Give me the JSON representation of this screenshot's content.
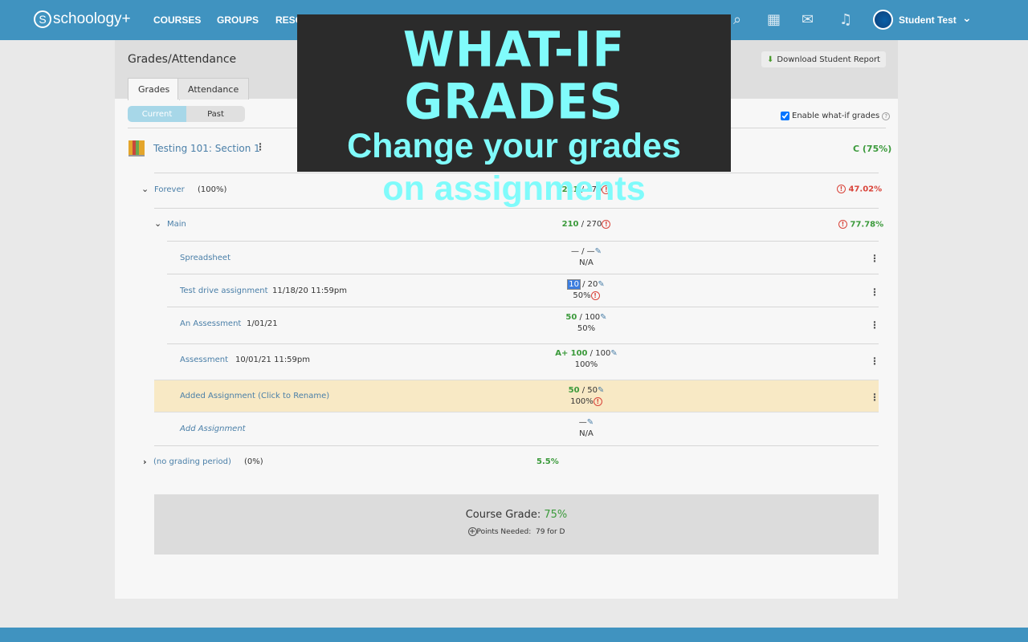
{
  "header": {
    "brand": "schoology+",
    "nav": [
      "COURSES",
      "GROUPS",
      "RESC"
    ],
    "user": "Student Test",
    "icons": [
      "search-icon",
      "calendar-icon",
      "mail-icon",
      "bell-icon"
    ]
  },
  "page": {
    "title": "Grades/Attendance",
    "tabs": [
      "Grades",
      "Attendance"
    ],
    "periods": [
      "Current",
      "Past"
    ],
    "download_label": "Download Student Report",
    "whatif_label": "Enable what-if grades",
    "whatif_checked": true
  },
  "course": {
    "name": "Testing 101: Section 1",
    "grade": "C (75%)"
  },
  "periods": [
    {
      "name": "Forever",
      "weight": "(100%)",
      "score": "221",
      "total": "470",
      "grade": "47.02%"
    },
    {
      "name": "(no grading period)",
      "weight": "(0%)",
      "grade": "5.5%"
    }
  ],
  "category": {
    "name": "Main",
    "score": "210",
    "total": "270",
    "grade": "77.78%"
  },
  "assignments": [
    {
      "name": "Spreadsheet",
      "due": "",
      "score": "—",
      "total": "—",
      "percent": "N/A"
    },
    {
      "name": "Test drive assignment",
      "due": "11/18/20 11:59pm",
      "score": "10",
      "total": "20",
      "percent": "50%",
      "warn": true,
      "editing": true
    },
    {
      "name": "An Assessment",
      "due": "1/01/21",
      "score": "50",
      "total": "100",
      "percent": "50%"
    },
    {
      "name": "Assessment",
      "due": "10/01/21 11:59pm",
      "letter": "A+",
      "score": "100",
      "total": "100",
      "percent": "100%"
    },
    {
      "name": "Added Assignment (Click to Rename)",
      "due": "",
      "score": "50",
      "total": "50",
      "percent": "100%",
      "warn": true,
      "highlighted": true
    }
  ],
  "add_assignment": {
    "label": "Add Assignment",
    "score": "—",
    "percent": "N/A"
  },
  "summary": {
    "label": "Course Grade:",
    "value": "75%",
    "points_label": "Points Needed:",
    "points_value": "79 for D"
  },
  "overlay": {
    "title": "WHAT-IF GRADES",
    "subtitle_line1": "Change your grades",
    "subtitle_line2": "on assignments"
  },
  "colors": {
    "header": "#4093c0",
    "overlay_bg": "#2b2b2b",
    "overlay_text": "#80fbfb",
    "highlight": "#f8e9c5",
    "green": "#3b9a3b",
    "warning": "#d9443a"
  }
}
